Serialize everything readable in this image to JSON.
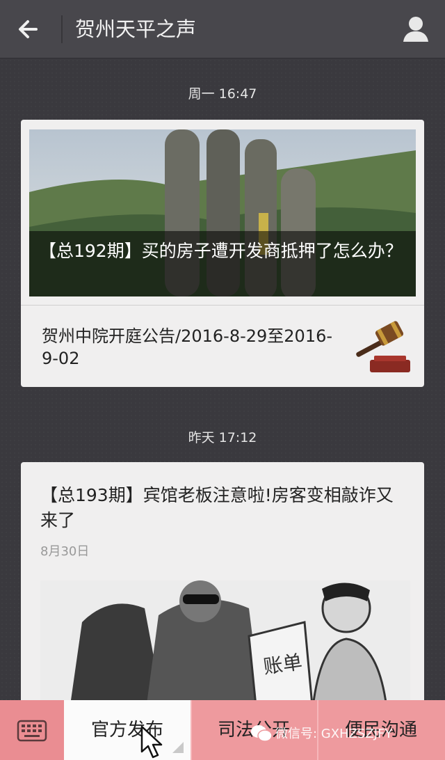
{
  "header": {
    "back_icon": "arrow-left-icon",
    "title": "贺州天平之声",
    "user_icon": "user-icon"
  },
  "messages": [
    {
      "timestamp": "周一 16:47",
      "cover_title": "【总192期】买的房子遭开发商抵押了怎么办？",
      "sub_item_title": "贺州中院开庭公告/2016-8-29至2016-9-02",
      "sub_item_icon": "gavel-icon"
    },
    {
      "timestamp": "昨天 17:12",
      "title": "【总193期】宾馆老板注意啦!房客变相敲诈又来了",
      "date": "8月30日",
      "illustration_text": "账单"
    }
  ],
  "bottom_menu": {
    "keyboard_icon": "keyboard-icon",
    "items": [
      "官方发布",
      "司法公开",
      "便民沟通"
    ]
  },
  "watermark": "微信号: GXHZSZJFY",
  "colors": {
    "header_bg": "#48474c",
    "chat_bg": "#3a393e",
    "menu_bg": "#ee9a9e",
    "menu_active_bg": "#fbfbfb"
  }
}
